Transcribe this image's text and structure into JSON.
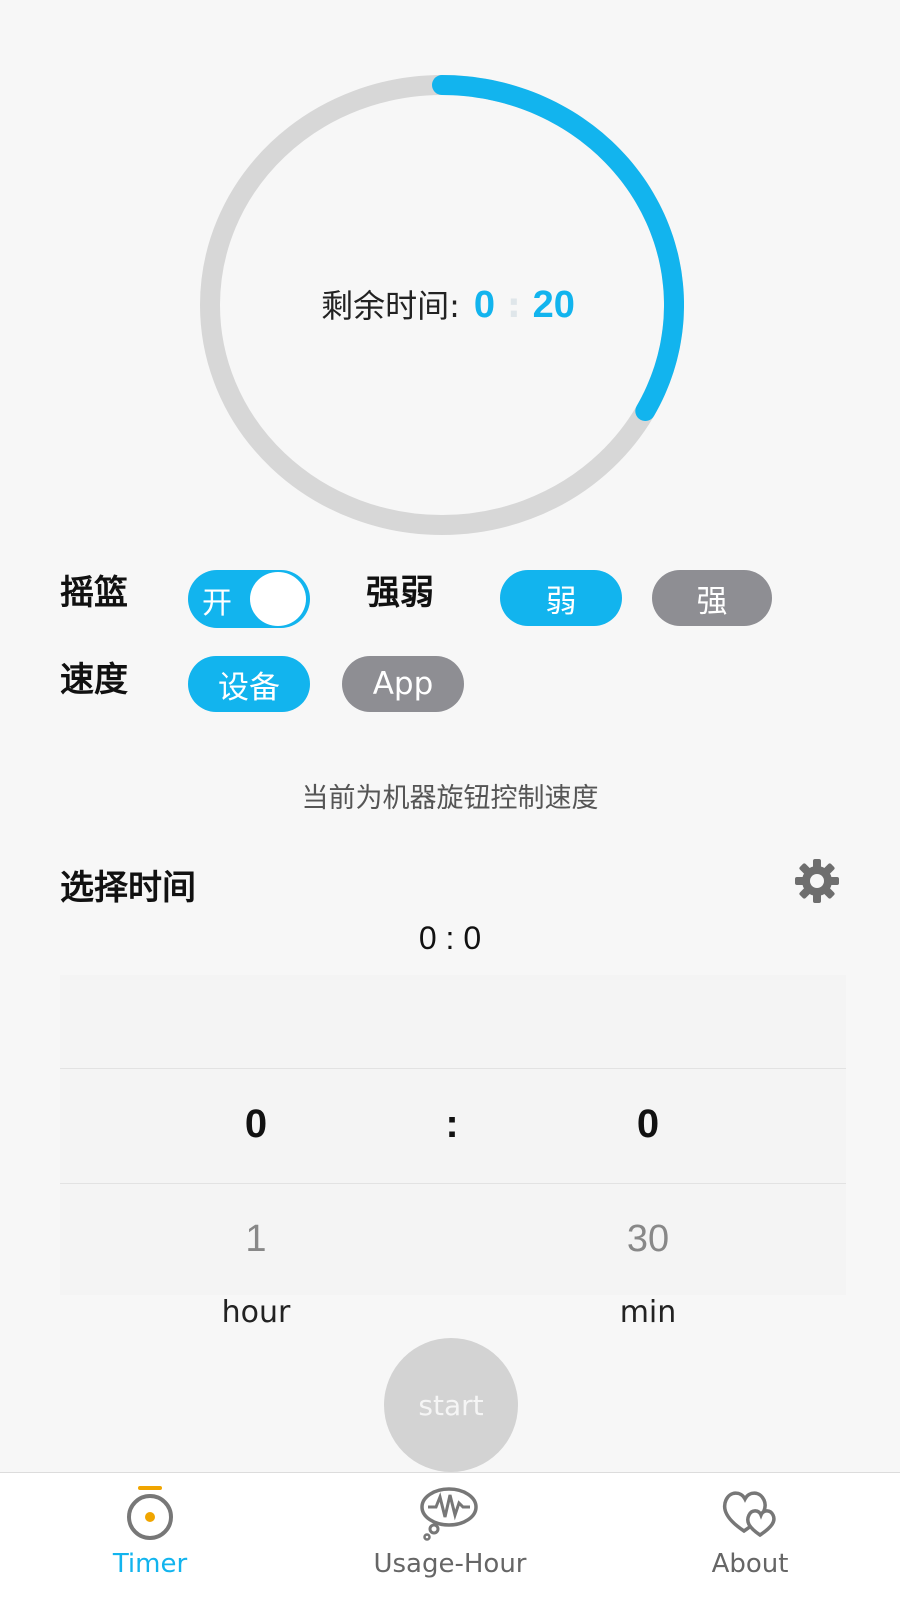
{
  "colors": {
    "accent": "#12b4ee",
    "inactive": "#8e8e93",
    "ring_track": "#d7d7d7",
    "timer_tab_icon": "#f0a500"
  },
  "remaining": {
    "label": "剩余时间:",
    "minutes": "0",
    "separator": ":",
    "seconds": "20",
    "progress_fraction": 0.33
  },
  "cradle": {
    "label": "摇篮",
    "toggle_text": "开"
  },
  "strength": {
    "label": "强弱",
    "weak": "弱",
    "strong": "强"
  },
  "speed": {
    "label": "速度",
    "device": "设备",
    "app": "App"
  },
  "hint": "当前为机器旋钮控制速度",
  "select_time": {
    "title": "选择时间",
    "value": "0 : 0",
    "hour_selected": "0",
    "separator": ":",
    "min_selected": "0",
    "hour_next": "1",
    "min_next": "30",
    "hour_unit": "hour",
    "min_unit": "min"
  },
  "start_label": "start",
  "tabs": [
    {
      "label": "Timer",
      "icon": "timer-icon",
      "active": true
    },
    {
      "label": "Usage-Hour",
      "icon": "usage-hour-icon",
      "active": false
    },
    {
      "label": "About",
      "icon": "about-heart-icon",
      "active": false
    }
  ]
}
